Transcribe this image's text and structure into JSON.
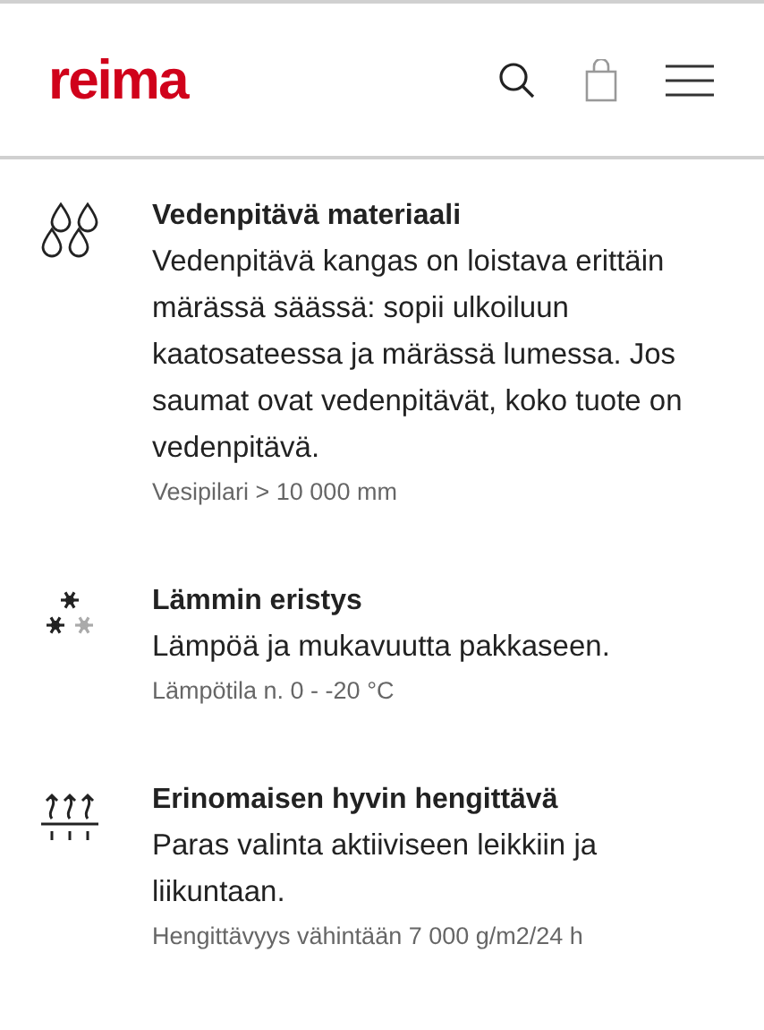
{
  "header": {
    "logo": "reima"
  },
  "features": [
    {
      "kind": "drops",
      "title": "Vedenpitävä materiaali",
      "description": "Vedenpitävä kangas on loistava erittäin märässä säässä: sopii ulkoiluun kaatosateessa ja märässä lumessa. Jos saumat ovat vedenpitävät, koko tuote on vedenpitävä.",
      "detail": "Vesipilari > 10 000 mm"
    },
    {
      "kind": "snowflakes",
      "title": "Lämmin eristys",
      "description": "Lämpöä ja mukavuutta pakkaseen.",
      "detail": "Lämpötila n. 0 - -20 °C"
    },
    {
      "kind": "vapour",
      "title": "Erinomaisen hyvin hengittävä",
      "description": "Paras valinta aktiiviseen leikkiin ja liikuntaan.",
      "detail": "Hengittävyys vähintään 7 000 g/m2/24 h"
    }
  ]
}
